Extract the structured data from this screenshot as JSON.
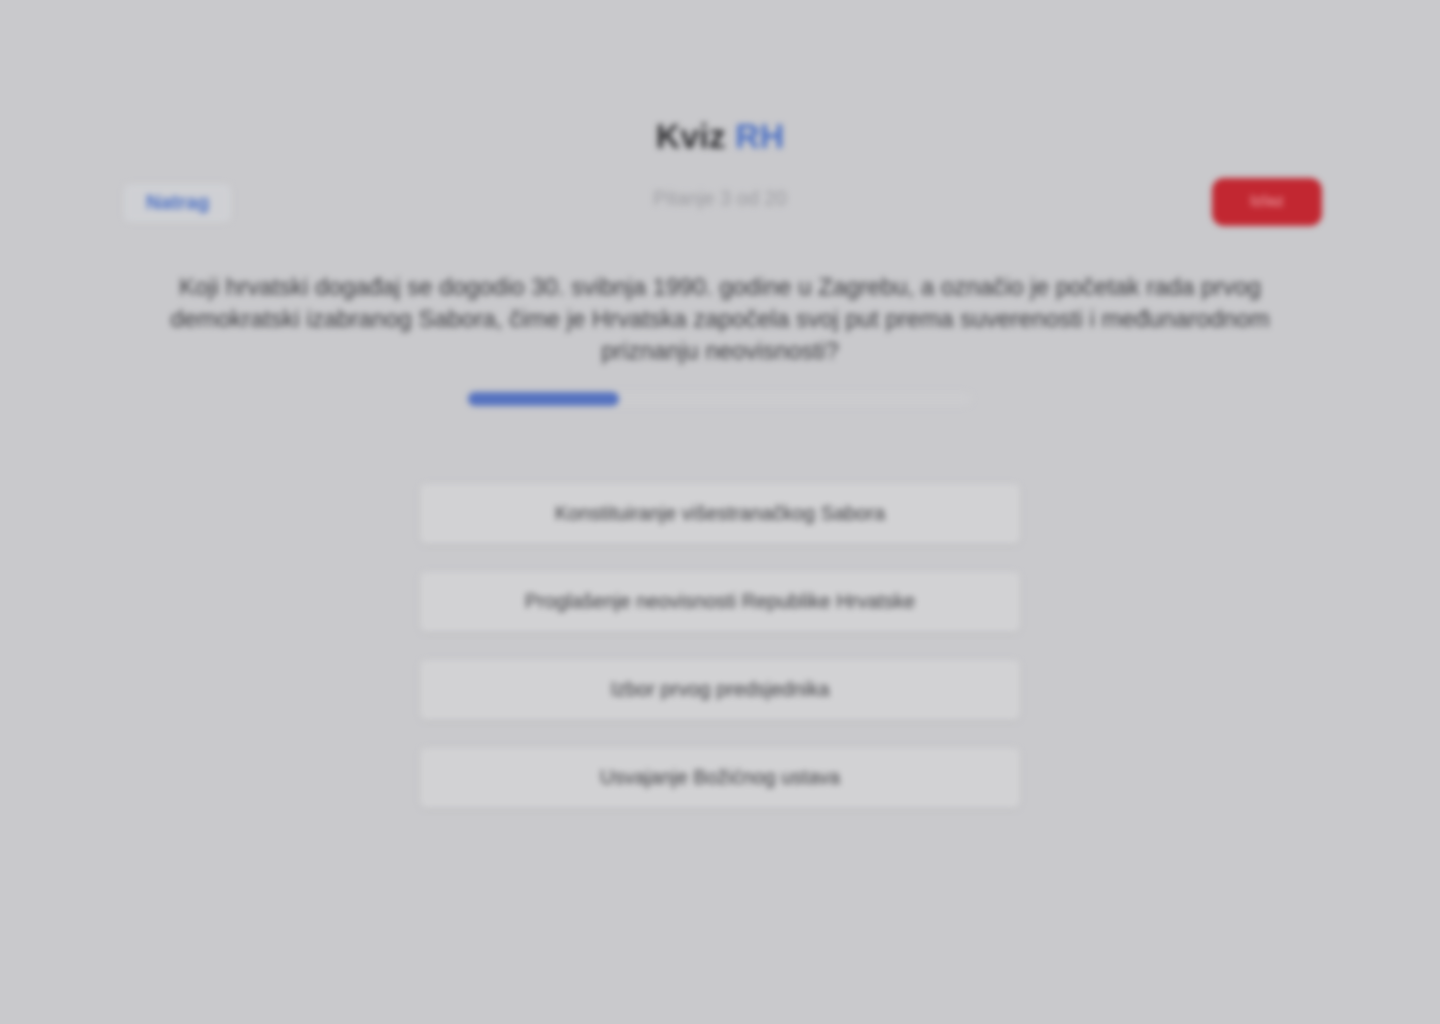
{
  "app": {
    "title_main": "Kviz",
    "title_accent": "RH"
  },
  "nav": {
    "back_label": "Natrag",
    "progress_label": "Pitanje 3 od 20",
    "exit_label": "Izlaz"
  },
  "question": {
    "text": "Koji hrvatski događaj se dogodio 30. svibnja 1990. godine u Zagrebu, a označio je početak rada prvog demokratski izabranog Sabora, čime je Hrvatska započela svoj put prema suverenosti i međunarodnom priznanju neovisnosti?",
    "progress_fraction": 0.3
  },
  "answers": [
    {
      "label": "Konstituiranje višestranačkog Sabora"
    },
    {
      "label": "Proglašenje neovisnosti Republike Hrvatske"
    },
    {
      "label": "Izbor prvog predsjednika"
    },
    {
      "label": "Usvajanje Božićnog ustava"
    }
  ],
  "colors": {
    "accent": "#4a6fc4",
    "exit": "#c22731",
    "background": "#c9c9cc"
  }
}
